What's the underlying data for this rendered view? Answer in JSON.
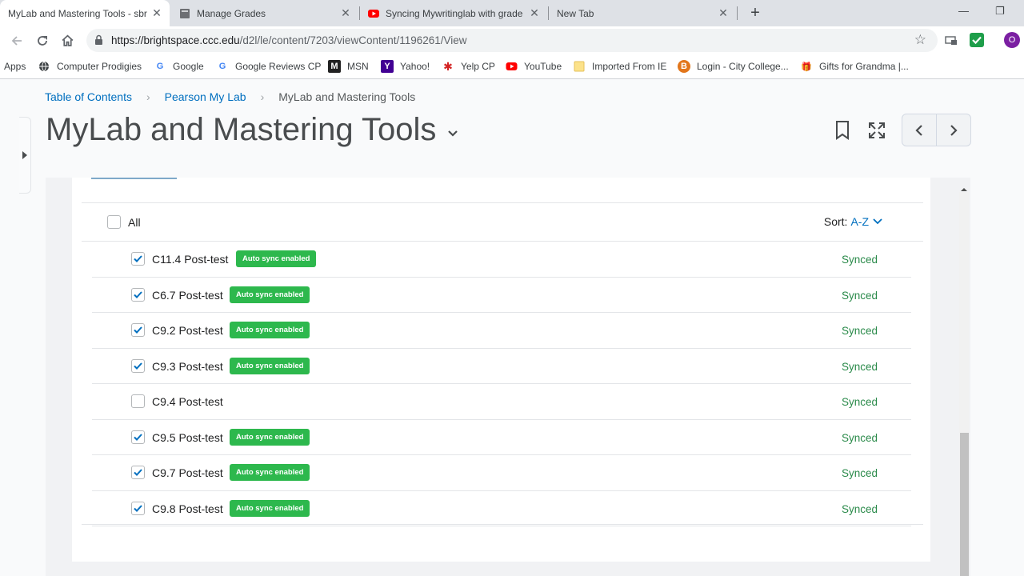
{
  "browser": {
    "tabs": [
      {
        "title": "MyLab and Mastering Tools - sbr",
        "active": true,
        "favicon": "brightspace-icon"
      },
      {
        "title": "Manage Grades",
        "active": false,
        "favicon": "page-icon"
      },
      {
        "title": "Syncing Mywritinglab with grade",
        "active": false,
        "favicon": "youtube-icon"
      },
      {
        "title": "New Tab",
        "active": false,
        "favicon": ""
      }
    ],
    "new_tab_label": "+",
    "url_host": "https://brightspace.ccc.edu",
    "url_path": "/d2l/le/content/7203/viewContent/1196261/View",
    "profile_initial": "O",
    "bookmarks": [
      {
        "label": "Apps",
        "icon": "apps-grid-icon"
      },
      {
        "label": "Computer Prodigies",
        "icon": "globe-icon"
      },
      {
        "label": "Google",
        "icon": "google-icon"
      },
      {
        "label": "Google Reviews CP",
        "icon": "google-icon"
      },
      {
        "label": "MSN",
        "icon": "msn-icon"
      },
      {
        "label": "Yahoo!",
        "icon": "yahoo-icon"
      },
      {
        "label": "Yelp CP",
        "icon": "yelp-icon"
      },
      {
        "label": "YouTube",
        "icon": "youtube-icon"
      },
      {
        "label": "Imported From IE",
        "icon": "folder-icon"
      },
      {
        "label": "Login - City College...",
        "icon": "ccc-icon"
      },
      {
        "label": "Gifts for Grandma |...",
        "icon": "gift-icon"
      }
    ]
  },
  "page": {
    "breadcrumbs": [
      "Table of Contents",
      "Pearson My Lab",
      "MyLab and Mastering Tools"
    ],
    "title": "MyLab and Mastering Tools",
    "list": {
      "all_label": "All",
      "sort_label": "Sort:",
      "sort_value": "A-Z",
      "rows": [
        {
          "name": "C11.4 Post-test",
          "checked": true,
          "badge": "Auto sync enabled",
          "status": "Synced"
        },
        {
          "name": "C6.7 Post-test",
          "checked": true,
          "badge": "Auto sync enabled",
          "status": "Synced"
        },
        {
          "name": "C9.2 Post-test",
          "checked": true,
          "badge": "Auto sync enabled",
          "status": "Synced"
        },
        {
          "name": "C9.3 Post-test",
          "checked": true,
          "badge": "Auto sync enabled",
          "status": "Synced"
        },
        {
          "name": "C9.4 Post-test",
          "checked": false,
          "badge": "",
          "status": "Synced"
        },
        {
          "name": "C9.5 Post-test",
          "checked": true,
          "badge": "Auto sync enabled",
          "status": "Synced"
        },
        {
          "name": "C9.7 Post-test",
          "checked": true,
          "badge": "Auto sync enabled",
          "status": "Synced"
        },
        {
          "name": "C9.8 Post-test",
          "checked": true,
          "badge": "Auto sync enabled",
          "status": "Synced"
        }
      ]
    }
  },
  "colors": {
    "link": "#006fbf",
    "badge": "#2db84d",
    "synced": "#2a8a4a",
    "checkmark": "#006fbf"
  }
}
